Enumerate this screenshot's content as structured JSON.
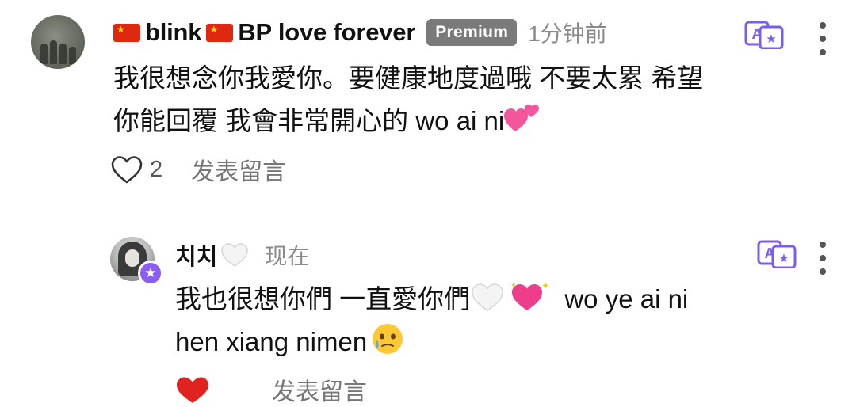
{
  "comments": [
    {
      "username": "blink",
      "username_part2": "BP love forever",
      "flag_icon": "china-flag-icon",
      "badge": "Premium",
      "time": "1分钟前",
      "text_line1": "我很想念你我愛你。要健康地度過哦 不要太累 希望",
      "text_line2": "你能回覆 我會非常開心的 wo ai ni",
      "text_emoji": "two-hearts-emoji",
      "likes": "2",
      "liked": false,
      "reply_label": "发表留言"
    },
    {
      "username": "치치",
      "name_emoji": "white-heart-emoji",
      "time": "现在",
      "text_line1": "我也很想你們 一直愛你們",
      "text_line1_tail": "wo ye ai ni",
      "text_line2": "hen xiang nimen",
      "text_emojis": [
        "white-heart-emoji",
        "sparkling-heart-emoji",
        "face-holding-back-tears-emoji"
      ],
      "liked": true,
      "reply_label": "发表留言",
      "creator_badge_icon": "star-icon"
    }
  ],
  "colors": {
    "accent": "#8b5cf6",
    "badge_bg": "#7a7a7a",
    "like_red": "#e0231e",
    "muted": "#8a8a8a"
  }
}
